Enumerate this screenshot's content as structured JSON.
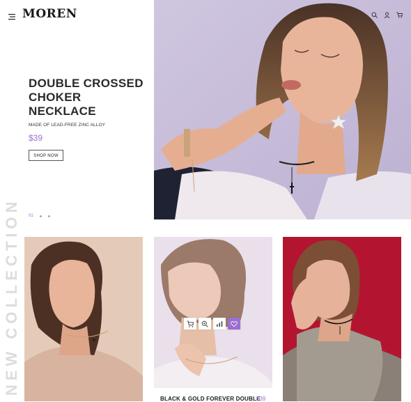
{
  "header": {
    "logo": "MOREN"
  },
  "hero": {
    "title_line1": "DOUBLE CROSSED",
    "title_line2": "CHOKER NECKLACE",
    "subtitle": "MADE OF LEAD-FREE ZINC ALLOY",
    "price": "$39",
    "cta": "SHOP NOW",
    "slide_number": "01"
  },
  "collection": {
    "vertical_title": "NEW COLLECTION",
    "featured_product": {
      "title": "BLACK & GOLD FOREVER DOUBLE",
      "price": "$39"
    }
  },
  "colors": {
    "accent": "#9b6fd0",
    "hero_bg": "#d5cce2",
    "card3_bg": "#b4152f"
  }
}
